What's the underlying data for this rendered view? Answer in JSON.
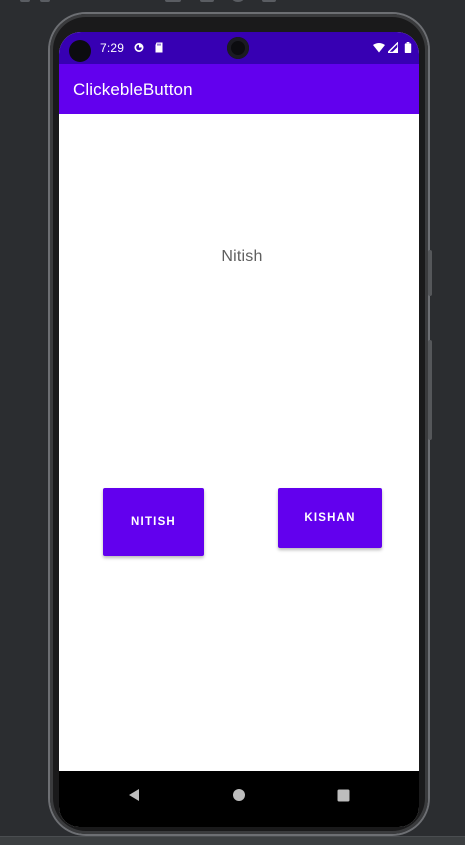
{
  "status_bar": {
    "time": "7:29",
    "background": "#3700b3",
    "icons": [
      "alarm-icon",
      "sd-card-icon",
      "wifi-icon",
      "signal-icon",
      "battery-icon"
    ]
  },
  "app_bar": {
    "title": "ClickebleButton",
    "background": "#6200ee"
  },
  "main": {
    "display_text": "Nitish",
    "buttons": [
      {
        "label": "Nitish",
        "color": "#6200ee"
      },
      {
        "label": "Kishan",
        "color": "#6200ee"
      }
    ]
  },
  "nav_bar": {
    "icons": [
      "back-icon",
      "home-icon",
      "recents-icon"
    ]
  }
}
